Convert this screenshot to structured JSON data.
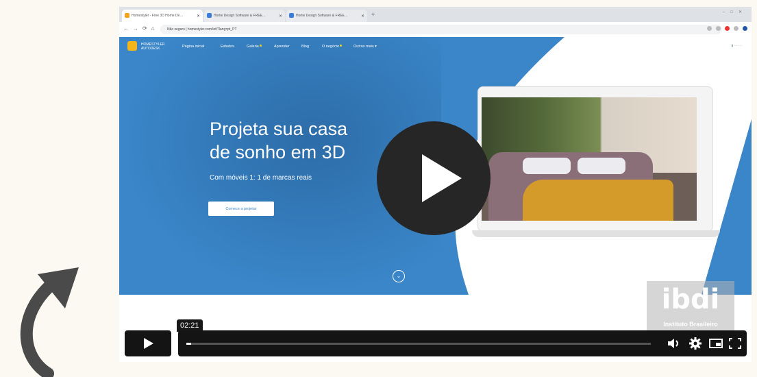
{
  "browser": {
    "tabs": [
      {
        "title": "Homestyler - Free 3D Home De…",
        "active": true
      },
      {
        "title": "Home Design Software & FREE…",
        "active": false
      },
      {
        "title": "Home Design Software & FREE…",
        "active": false
      }
    ],
    "new_tab": "+",
    "url": "Não seguro | homestyler.com/int/?lang=pt_PT"
  },
  "site": {
    "logo_text": "HOMESTYLER AUTODESK",
    "nav": [
      {
        "label": "Página inicial",
        "dot": false
      },
      {
        "label": "Estudos",
        "dot": false
      },
      {
        "label": "Galeria",
        "dot": true
      },
      {
        "label": "Aprender",
        "dot": false
      },
      {
        "label": "Blog",
        "dot": false
      },
      {
        "label": "O negócio",
        "dot": true
      },
      {
        "label": "Outros mais ▾",
        "dot": false
      }
    ],
    "hero_title_line1": "Projeta sua casa",
    "hero_title_line2": "de sonho em 3D",
    "hero_subtitle": "Com móveis 1: 1 de marcas reais",
    "cta_label": "Comece a projetar",
    "scroll_icon": "chevron-down-circle-icon"
  },
  "watermark": {
    "logo": "ibdi",
    "subtitle": "Instituto Brasileiro"
  },
  "player": {
    "big_play_icon": "play-icon",
    "time_tooltip": "02:21",
    "progress_fraction": 0.01,
    "controls": {
      "play_icon": "play-icon",
      "volume_icon": "volume-icon",
      "settings_icon": "gear-icon",
      "pip_icon": "picture-in-picture-icon",
      "fullscreen_icon": "fullscreen-icon"
    }
  },
  "colors": {
    "site_blue": "#3a86c8",
    "player_dark": "#141414",
    "page_bg": "#fbf9f1",
    "arrow": "#4a4a4a"
  }
}
